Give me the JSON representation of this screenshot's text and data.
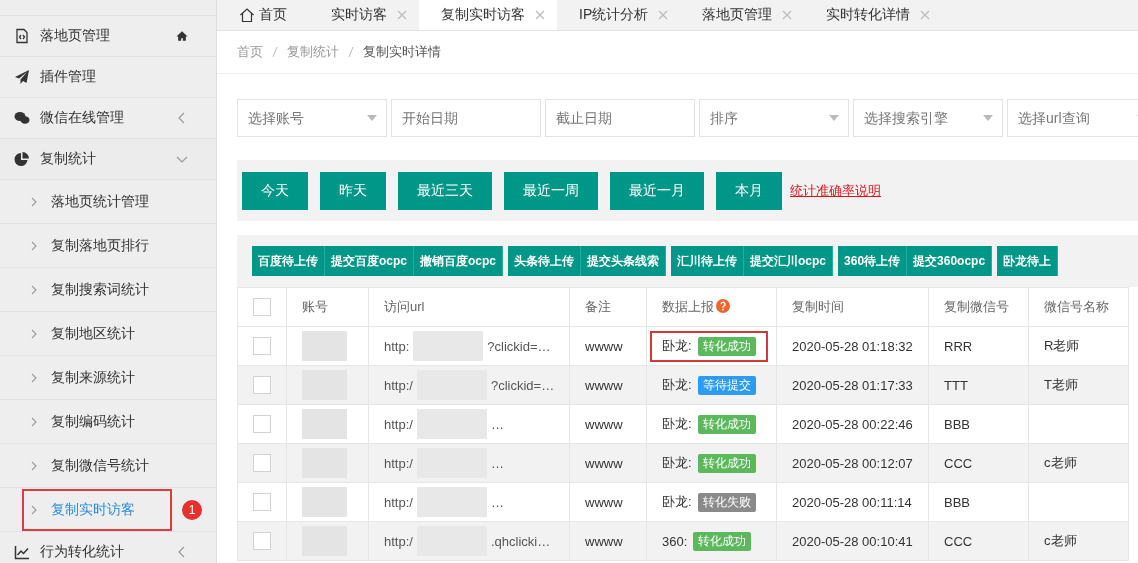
{
  "sidebar": {
    "items": [
      {
        "label": "落地页管理"
      },
      {
        "label": "插件管理"
      },
      {
        "label": "微信在线管理",
        "expanded": false
      },
      {
        "label": "复制统计",
        "expanded": true,
        "children": [
          {
            "label": "落地页统计管理",
            "selected": false
          },
          {
            "label": "复制落地页排行",
            "selected": false
          },
          {
            "label": "复制搜索词统计",
            "selected": false
          },
          {
            "label": "复制地区统计",
            "selected": false
          },
          {
            "label": "复制来源统计",
            "selected": false
          },
          {
            "label": "复制编码统计",
            "selected": false
          },
          {
            "label": "复制微信号统计",
            "selected": false
          },
          {
            "label": "复制实时访客",
            "selected": true,
            "badge": "1"
          }
        ]
      },
      {
        "label": "行为转化统计",
        "expanded": false
      }
    ]
  },
  "tabs": [
    {
      "label": "首页",
      "kind": "home",
      "selected": false
    },
    {
      "label": "实时访客",
      "kind": "closable",
      "selected": false
    },
    {
      "label": "复制实时访客",
      "kind": "closable",
      "selected": true
    },
    {
      "label": "IP统计分析",
      "kind": "closable",
      "selected": false
    },
    {
      "label": "落地页管理",
      "kind": "closable",
      "selected": false
    },
    {
      "label": "实时转化详情",
      "kind": "closable",
      "selected": false
    }
  ],
  "breadcrumb": [
    "首页",
    "复制统计",
    "复制实时详情"
  ],
  "filters": [
    {
      "kind": "select",
      "placeholder": "选择账号"
    },
    {
      "kind": "input",
      "placeholder": "开始日期"
    },
    {
      "kind": "input",
      "placeholder": "截止日期"
    },
    {
      "kind": "select",
      "placeholder": "排序"
    },
    {
      "kind": "select",
      "placeholder": "选择搜索引擎"
    },
    {
      "kind": "select",
      "placeholder": "选择url查询"
    }
  ],
  "quick_buttons": [
    "今天",
    "昨天",
    "最近三天",
    "最近一周",
    "最近一月",
    "本月"
  ],
  "accuracy_link": "统计准确率说明",
  "upload_groups": [
    [
      "百度待上传",
      "提交百度ocpc",
      "撤销百度ocpc"
    ],
    [
      "头条待上传",
      "提交头条线索"
    ],
    [
      "汇川待上传",
      "提交汇川ocpc"
    ],
    [
      "360待上传",
      "提交360ocpc"
    ],
    [
      "卧龙待上"
    ]
  ],
  "table": {
    "columns": [
      "账号",
      "访问url",
      "备注",
      "数据上报",
      "复制时间",
      "复制微信号",
      "微信号名称"
    ],
    "header_checked": false,
    "rows": [
      {
        "checked": false,
        "url_start": "http:",
        "url_end": "?clickid=…",
        "note": "wwww",
        "source": "卧龙:",
        "status": "转化成功",
        "color": "#5cb85c",
        "highlighted": true,
        "time": "2020-05-28 01:18:32",
        "wechat": "RRR",
        "wechat_name": "R老师"
      },
      {
        "checked": false,
        "url_start": "http:/",
        "url_end": "?clickid=…",
        "note": "wwww",
        "source": "卧龙:",
        "status": "等待提交",
        "color": "#2d9cf0",
        "highlighted": false,
        "time": "2020-05-28 01:17:33",
        "wechat": "TTT",
        "wechat_name": "T老师"
      },
      {
        "checked": false,
        "url_start": "http:/",
        "url_end": "…",
        "note": "wwww",
        "source": "卧龙:",
        "status": "转化成功",
        "color": "#5cb85c",
        "highlighted": false,
        "time": "2020-05-28 00:22:46",
        "wechat": "BBB",
        "wechat_name": ""
      },
      {
        "checked": false,
        "url_start": "http:/",
        "url_end": "…",
        "note": "wwww",
        "source": "卧龙:",
        "status": "转化成功",
        "color": "#5cb85c",
        "highlighted": false,
        "time": "2020-05-28 00:12:07",
        "wechat": "CCC",
        "wechat_name": "c老师"
      },
      {
        "checked": false,
        "url_start": "http:/",
        "url_end": "…",
        "note": "wwww",
        "source": "卧龙:",
        "status": "转化失败",
        "color": "#8a8a8a",
        "highlighted": false,
        "time": "2020-05-28 00:11:14",
        "wechat": "BBB",
        "wechat_name": ""
      },
      {
        "checked": false,
        "url_start": "http:/",
        "url_end": ".qhclicki…",
        "note": "wwww",
        "source": "360:",
        "status": "转化成功",
        "color": "#5cb85c",
        "highlighted": false,
        "time": "2020-05-28 00:10:41",
        "wechat": "CCC",
        "wechat_name": "c老师"
      }
    ]
  }
}
